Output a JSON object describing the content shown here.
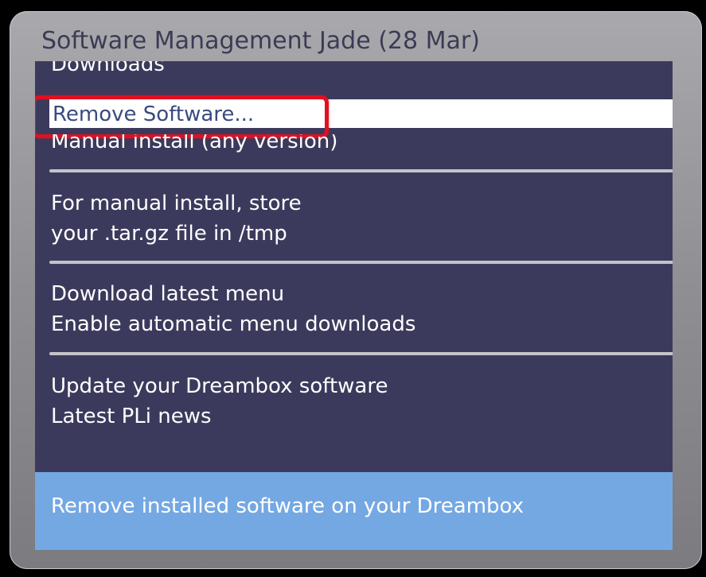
{
  "window": {
    "title": "Software Management Jade (28 Mar)"
  },
  "menu": {
    "downloads_label": "Downloads",
    "selected_label": "Remove Software...",
    "manual_install_label": "Manual install (any version)",
    "manual_note_line1": "For manual install, store",
    "manual_note_line2": "your .tar.gz file in /tmp",
    "download_menu_label": "Download latest menu",
    "auto_downloads_label": "Enable automatic menu downloads",
    "update_label": "Update your Dreambox software",
    "news_label": "Latest PLi news"
  },
  "status": {
    "description": "Remove installed software on your Dreambox"
  },
  "colors": {
    "panel": "#3c3a5c",
    "selection": "#ffffff",
    "highlight_outline": "#e01020",
    "info_bar": "#74a8e3"
  }
}
